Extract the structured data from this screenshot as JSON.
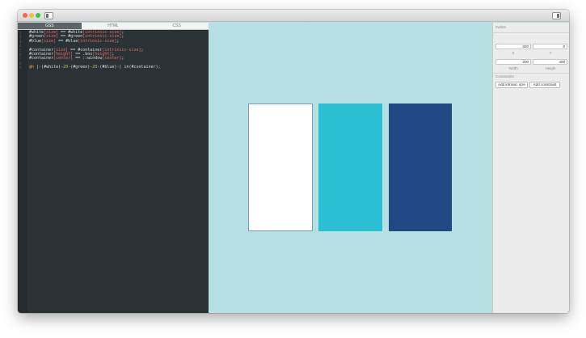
{
  "window": {
    "tabs": [
      {
        "label": "GSS",
        "active": true
      },
      {
        "label": "HTML",
        "active": false
      },
      {
        "label": "CSS",
        "active": false
      }
    ]
  },
  "editor": {
    "line_numbers": [
      "1",
      "2",
      "3",
      "4",
      "5",
      "6",
      "7",
      "8",
      "9"
    ],
    "lines": [
      [
        {
          "t": "#white",
          "c": "t"
        },
        {
          "t": "[size]",
          "c": "p"
        },
        {
          "t": " == #white",
          "c": "t"
        },
        {
          "t": "[intrinsic-size]",
          "c": "p"
        },
        {
          "t": ";",
          "c": "t"
        }
      ],
      [
        {
          "t": "#green",
          "c": "t"
        },
        {
          "t": "[size]",
          "c": "p"
        },
        {
          "t": " == #green",
          "c": "t"
        },
        {
          "t": "[intrinsic-size]",
          "c": "p"
        },
        {
          "t": ";",
          "c": "t"
        }
      ],
      [
        {
          "t": "#blue",
          "c": "t"
        },
        {
          "t": "[size]",
          "c": "p"
        },
        {
          "t": " == #blue",
          "c": "t"
        },
        {
          "t": "[intrinsic-size]",
          "c": "p"
        },
        {
          "t": ";",
          "c": "t"
        }
      ],
      [],
      [
        {
          "t": "#container",
          "c": "t"
        },
        {
          "t": "[size]",
          "c": "p"
        },
        {
          "t": " == #container",
          "c": "t"
        },
        {
          "t": "[intrinsic-size]",
          "c": "p"
        },
        {
          "t": ";",
          "c": "t"
        }
      ],
      [
        {
          "t": "#container",
          "c": "t"
        },
        {
          "t": "[height]",
          "c": "p"
        },
        {
          "t": " == .box",
          "c": "t"
        },
        {
          "t": "[height]",
          "c": "p"
        },
        {
          "t": ";",
          "c": "t"
        }
      ],
      [
        {
          "t": "#container",
          "c": "t"
        },
        {
          "t": "[center]",
          "c": "p"
        },
        {
          "t": " == ::window",
          "c": "t"
        },
        {
          "t": "[center]",
          "c": "p"
        },
        {
          "t": ";",
          "c": "t"
        }
      ],
      [],
      [
        {
          "t": "@h",
          "c": "o"
        },
        {
          "t": " |-(#white)-",
          "c": "t"
        },
        {
          "t": "20",
          "c": "n"
        },
        {
          "t": "-(#green)-",
          "c": "t"
        },
        {
          "t": "20",
          "c": "n"
        },
        {
          "t": "-(#blue)-| in(#container);",
          "c": "t"
        }
      ]
    ]
  },
  "panel": {
    "title": "#white",
    "x_value": "-320",
    "y_value": "0",
    "x_label": "X",
    "y_label": "Y",
    "width_value": "200",
    "height_value": "400",
    "width_label": "Width",
    "height_label": "Height",
    "constraints_title": "Constraints",
    "add_intrinsic_label": "Add intrinsic size",
    "add_constraint_label": "Add constraint"
  },
  "colors": {
    "stage_bg": "#b7e0e4",
    "white_box": "#ffffff",
    "green_box": "#2bbfd4",
    "blue_box": "#1f4885"
  }
}
